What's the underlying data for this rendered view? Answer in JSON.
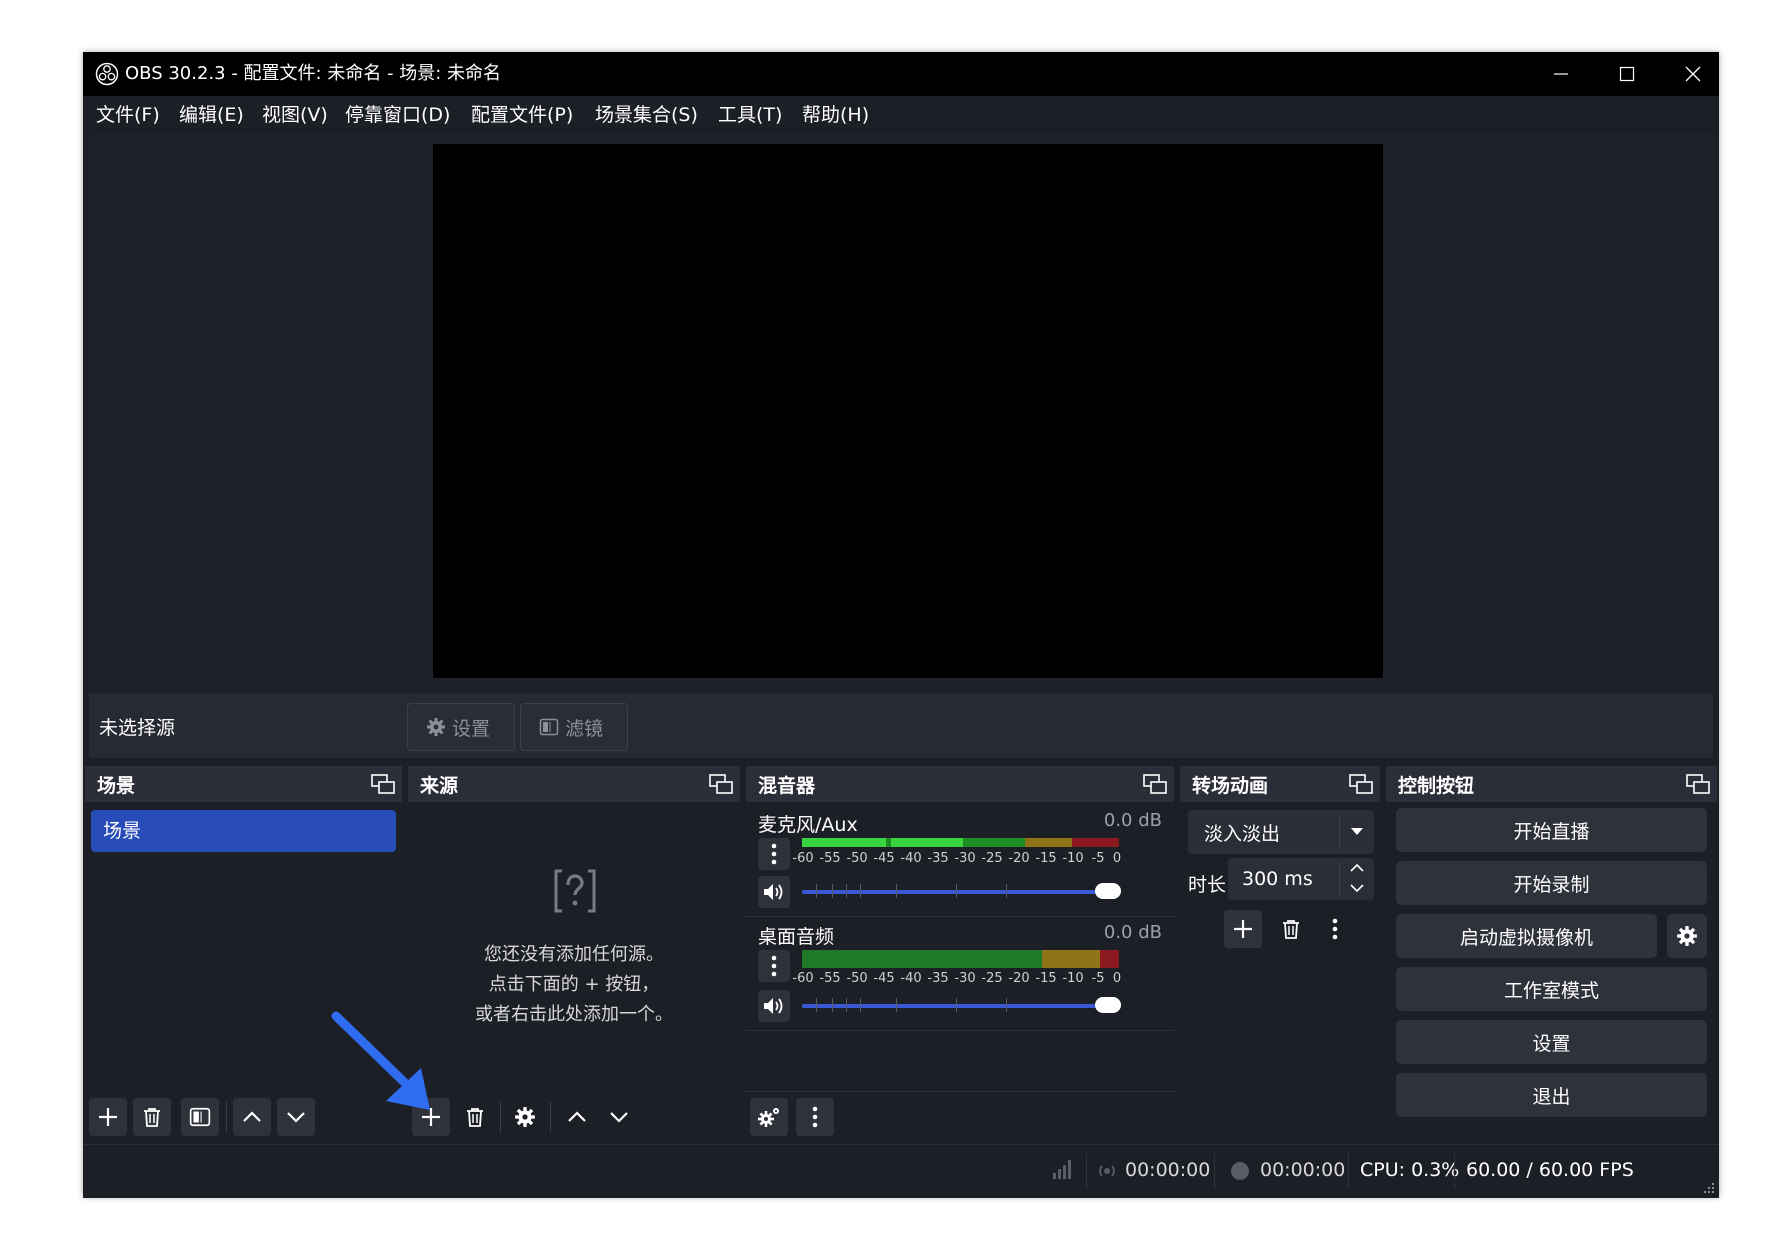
{
  "window": {
    "title": "OBS 30.2.3 - 配置文件: 未命名 - 场景: 未命名"
  },
  "menu": [
    "文件(F)",
    "编辑(E)",
    "视图(V)",
    "停靠窗口(D)",
    "配置文件(P)",
    "场景集合(S)",
    "工具(T)",
    "帮助(H)"
  ],
  "source_bar": {
    "label": "未选择源",
    "settings": "设置",
    "filters": "滤镜"
  },
  "scenes": {
    "title": "场景",
    "items": [
      "场景"
    ]
  },
  "sources": {
    "title": "来源",
    "empty_lines": [
      "您还没有添加任何源。",
      "点击下面的 + 按钮，",
      "或者右击此处添加一个。"
    ]
  },
  "mixer": {
    "title": "混音器",
    "ticks": [
      "-60",
      "-55",
      "-50",
      "-45",
      "-40",
      "-35",
      "-30",
      "-25",
      "-20",
      "-15",
      "-10",
      "-5",
      "0"
    ],
    "channels": [
      {
        "name": "麦克风/Aux",
        "db": "0.0 dB",
        "volume": 1.0
      },
      {
        "name": "桌面音频",
        "db": "0.0 dB",
        "volume": 1.0
      }
    ]
  },
  "transitions": {
    "title": "转场动画",
    "type": "淡入淡出",
    "duration_label": "时长",
    "duration": "300 ms"
  },
  "controls": {
    "title": "控制按钮",
    "buttons": [
      "开始直播",
      "开始录制",
      "启动虚拟摄像机",
      "工作室模式",
      "设置",
      "退出"
    ]
  },
  "status": {
    "stream_time": "00:00:00",
    "record_time": "00:00:00",
    "cpu": "CPU: 0.3%",
    "fps": "60.00 / 60.00 FPS"
  },
  "colors": {
    "accent": "#284cb8",
    "volume": "#3b59d6",
    "annotation_arrow": "#2f6cf0"
  }
}
